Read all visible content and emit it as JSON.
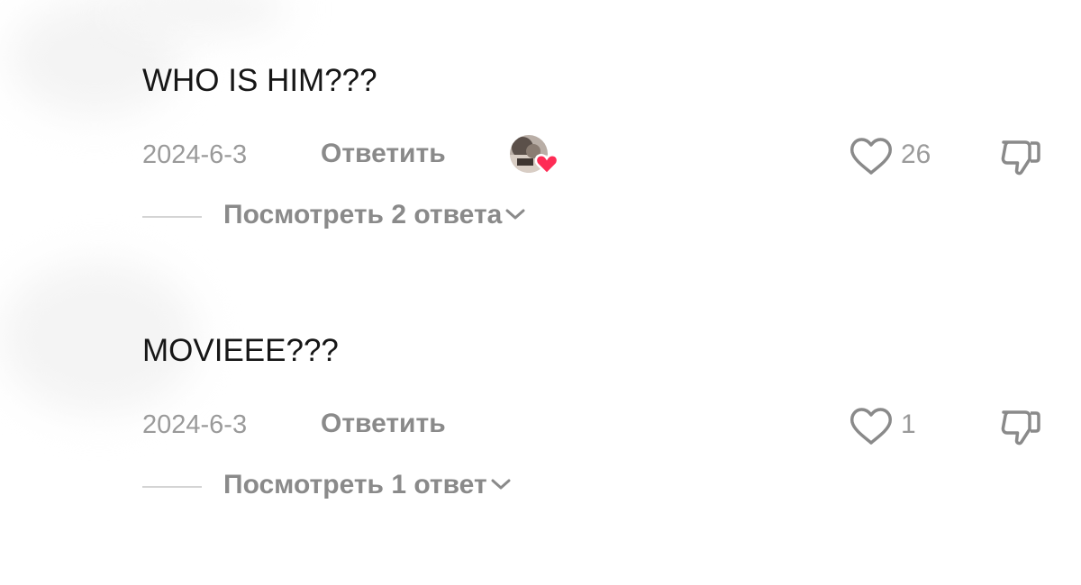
{
  "comments": [
    {
      "text": "WHO IS HIM???",
      "date": "2024-6-3",
      "reply_label": "Ответить",
      "liked_by_creator": true,
      "like_count": "26",
      "view_replies_label": "Посмотреть 2 ответа"
    },
    {
      "text": "MOVIEEE???",
      "date": "2024-6-3",
      "reply_label": "Ответить",
      "liked_by_creator": false,
      "like_count": "1",
      "view_replies_label": "Посмотреть 1 ответ"
    }
  ],
  "icons": {
    "like": "heart-outline-icon",
    "dislike": "thumbs-down-icon",
    "creator_like": "creator-heart-icon",
    "expand": "chevron-down-icon"
  },
  "colors": {
    "text": "#161616",
    "muted": "#9a9a9a",
    "action": "#8a8a8a",
    "creator_heart": "#fe2c55",
    "background": "#ffffff"
  }
}
